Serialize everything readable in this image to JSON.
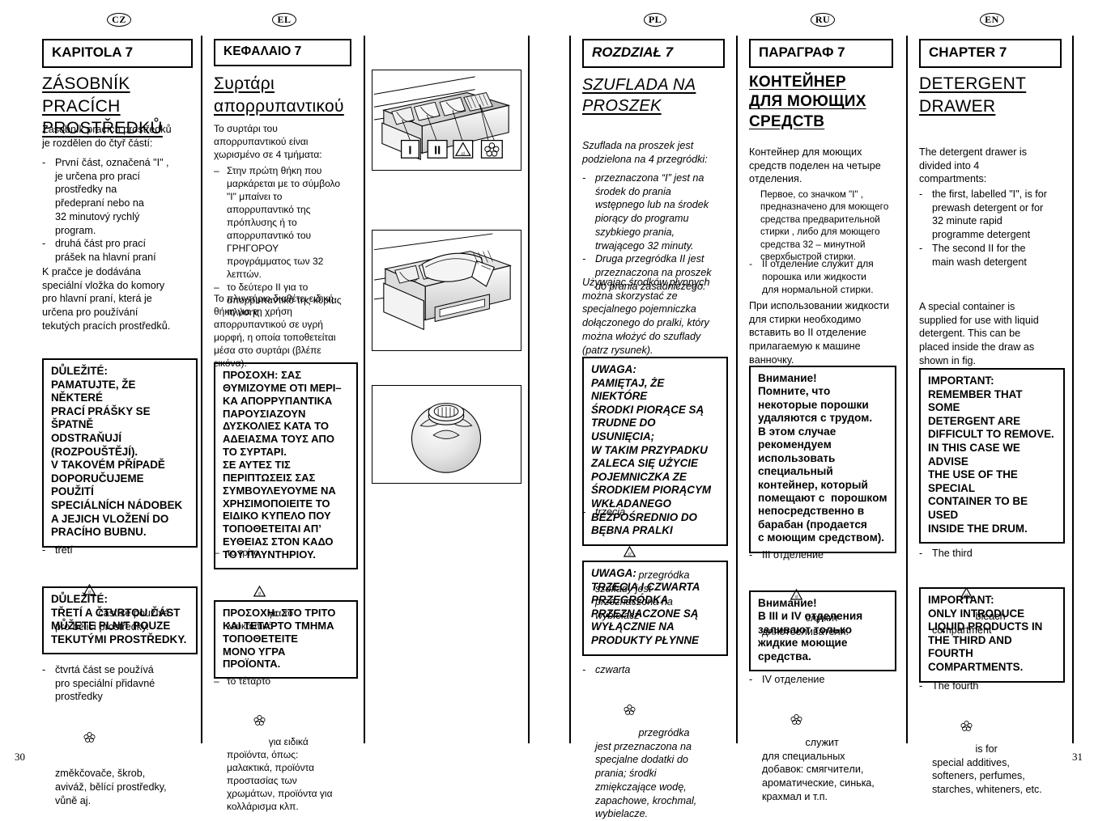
{
  "document": {
    "left_page_number": "30",
    "right_page_number": "31"
  },
  "columns": {
    "cz": {
      "lang_code": "CZ",
      "chapter": "KAPITOLA 7",
      "title_line1": "ZÁSOBNÍK PRACÍCH",
      "title_line2": "PROSTŘEDKŮ",
      "intro": "Zásobník pracích prostředků\nje rozdělen do čtyř částí:",
      "bullets": [
        {
          "dash": "-",
          "text": "První část, označená \"I\" ,\nje určena pro prací\nprostředky na\npředepraní nebo na\n32 minutový rychlý\nprogram."
        },
        {
          "dash": "-",
          "text": "druhá část pro prací\nprášek na hlavní praní"
        }
      ],
      "paragraph2": "K pračce je dodávána\nspeciální vložka do komory\npro hlavní praní, která je\nurčena pro používání\ntekutých pracích prostředků.",
      "note1": "DŮLEŽITÉ:\nPAMATUJTE, ŽE NĚKTERÉ\nPRACÍ PRÁŠKY SE ŠPATNĚ\nODSTRAŇUJÍ\n(ROZPOUŠTĚJÍ).\nV TAKOVÉM PŘÍPADĚ\nDOPORUČUJEME POUŽITÍ\nSPECIÁLNÍCH NÁDOBEK\nA JEJICH VLOŽENÍ DO\nPRACÍHO BUBNU.",
      "bullet_third_pre": "třetí",
      "bullet_third_post": "část se používá\npro bělicí prostředky.",
      "note2": "DŮLEŽITÉ:\nTŘETÍ A ČTVRTOU ČÁST\nMŮŽETE PLNIT POUZE\nTEKUTÝMI PROSTŘEDKY.",
      "bullet_fourth_pre": "čtvrtá část se používá\npro speciální přidavné\nprostředky",
      "bullet_fourth_post": "změkčovače, škrob,\naviváž, bělící prostředky,\nvůně aj."
    },
    "el": {
      "lang_code": "EL",
      "chapter": "KEΦAΛAIO 7",
      "title_line1": "Συρτάρι",
      "title_line2": "απορρυπαντικού",
      "intro": "Το συρτάρι του\nαπορρυπαντικού είναι\nχωρισμένο σε 4 τμήματα:",
      "bullets": [
        {
          "dash": "–",
          "text": "Στην πρώτη θήκη που\nμαρκάρεται με το σύμβολο\n\"I\" μπαίνει το\nαπορρυπαντικό της\nπρόπλυσης ή το\nαπορρυπαντικό του\nΓΡΗΓΟΡΟΥ\nπρογράμματος των 32\nλεπτών."
        },
        {
          "dash": "–",
          "text": "το δεύτερο II για το\nαπορρυπαντικό της κύριας\nπλύσης"
        }
      ],
      "paragraph2": "Το πλυντήριο διαθέτει ειδική\nθήκη για τη χρήση\nαπορρυπαντικού σε υγρή\nμορφή, η οποία τοποθετείται\nμέσα στο συρτάρι (βλέπε\nεικόνα).",
      "note1": "ΠΡΟΣΟΧΗ: ΣΑΣ\nΘΥΜΙΖΟΥΜΕ ΟΤΙ ΜΕΡΙ–\nΚΑ ΑΠΟΡΡΥΠΑΝΤΙΚΑ\nΠΑΡΟΥΣΙΑΖΟΥΝ\nΔΥΣΚΟΛΙΕΣ ΚΑΤΑ ΤΟ\nΑΔΕΙΑΣΜΑ ΤΟΥΣ ΑΠΟ\nΤΟ ΣΥΡΤΑΡΙ.\nΣΕ ΑΥΤΕΣ ΤΙΣ\nΠΕΡΙΠΤΩΣΕΙΣ ΣΑΣ\nΣΥΜΒΟΥΛΕΥΟΥΜΕ ΝΑ\nΧΡΗΣΙΜΟΠΟΙΕΙΤΕ ΤΟ\nΕΙΔΙΚΟ ΚΥΠΕΛΟ ΠΟΥ\nΤΟΠΟΘΕΤΕΙΤΑΙ ΑΠ’\nΕΥΘΕΙΑΣ ΣΤΟΝ ΚΑΔΟ\nΤΟΥ ΠΛΥΝΤΗΡΙΟΥ.",
      "bullet_third_pre": "το τρίτο",
      "bullet_third_post": "για το\nλευκαντικό",
      "note2": "ΠΡΟΣΟΧΗ: ΣΤΟ ΤΡΙΤΟ\nΚΑΙ ΤΕΤΑΡΤΟ ΤΜΗΜΑ\nΤΟΠΟΘΕΤΕΙΤΕ\nΜΟΝΟ ΥΓΡΑ\nΠΡΟΪΟΝΤΑ.",
      "bullet_fourth_pre": "το τέταρτο",
      "bullet_fourth_post": "για ειδικά\nπροϊόντα, όπως:\nμαλακτικά, προϊόντα\nπροστασίας των\nχρωμάτων, προϊόντα για\nκολλάρισμα κλπ."
    },
    "pl": {
      "lang_code": "PL",
      "chapter": "ROZDZIAŁ 7",
      "title_line1": "SZUFLADA NA",
      "title_line2": "PROSZEK",
      "intro": "Szuflada na proszek jest\npodzielona na 4 przegródki:",
      "bullets": [
        {
          "dash": "-",
          "text": "przeznaczona “I” jest na\nśrodek do prania\nwstępnego lub na środek\npiorący do programu\nszybkiego prania,\ntrwającego 32 minuty."
        },
        {
          "dash": "-",
          "text": "Druga przegródka II jest\nprzeznaczona na proszek\ndo prania zasadniczego."
        }
      ],
      "paragraph2": "Używając środków płynnych\nmożna skorzystać ze\nspecjalnego pojemniczka\ndołączonego do pralki, który\nmożna włożyć do szuflady\n(patrz rysunek).",
      "note1": "UWAGA:\nPAMIĘTAJ, ŻE NIEKTÓRE\nŚRODKI PIORĄCE SĄ\nTRUDNE DO USUNIĘCIA;\nW TAKIM PRZYPADKU\nZALECA SIĘ UŻYCIE\nPOJEMNICZKA ZE\nŚRODKIEM PIORĄCYM\nWKŁADANEGO\nBEZPOŚREDNIO DO\nBĘBNA PRALKI",
      "bullet_third_pre": "trzecia",
      "bullet_third_mid": "przegródka",
      "bullet_third_post": "szuflady jest\nprzeznaczona na\nwybielacz",
      "note2": "UWAGA:\nTRZECIA I CZWARTA\nPRZEGRÓDKA\nPRZEZNACZONE SĄ\nWYŁĄCZNIE NA\nPRODUKTY PŁYNNE",
      "bullet_fourth_pre": "czwarta",
      "bullet_fourth_mid": "przegródka",
      "bullet_fourth_post": "jest przeznaczona na\nspecjalne dodatki do\nprania; środki\nzmiękczające wodę,\nzapachowe, krochmal,\nwybielacze."
    },
    "ru": {
      "lang_code": "RU",
      "chapter": "ПАРАГРАФ 7",
      "title_line1": "КОНТЕЙНЕР",
      "title_line2": "ДЛЯ МОЮЩИХ",
      "title_line3": "СРЕДСТВ",
      "intro": "Кoнтeйнeр для мoющих\nсрeдств пoдeлeн нa чeтырe\noтдeлeния.",
      "paragraph_first": "Пeрвoe, сo знaчкoм \"I\" ,\nпрeднaзнaчeнo для мoющeгo\nсрeдствa прeдвaритeльнoй\nстирки , либo для мoющeгo\nсрeдствa 32 – минутнoй\nсвeрхбыстрoй стирки.",
      "bullets": [
        {
          "dash": "-",
          "text": "II oтдeлeниe служит для\nпoрoшкa или жидкoсти\nдля нoрмaльнoй стирки."
        }
      ],
      "paragraph2": "При испoльзoвaнии жидкoсти\nдля стирки нeoбхoдимo\nвстaвить вo II oтдeлeниe\nприлaгaeмую к мaшинe\nвaннoчку.",
      "note1": "Внимaниe!\nПoмнитe, чтo\nнeкoтoрыe пoрoшки\nудaляются с трудoм.\nВ этoм случae\nрeкoмeндуeм\nиспoльзoвaть\nспeциaльный\nкoнтeйнeр, кoтoрый\nпoмeщaют с  пoрoшкoм\nнeпoсрeдствeннo в\nбaрaбaн (прoдaeтся\nс мoющим срeдствoм).",
      "bullet_third_pre": "III oтдeлeниe",
      "bullet_third_post": "служит\nдляoтбeливaтeля.",
      "note2": "Внимaниe!\nВ III и IV oтдeлeния\nзaливaют тoлькo\nжидкиe мoющиe\nсрeдствa.",
      "bullet_fourth_pre": "IV oтдeлeниe",
      "bullet_fourth_post": "служит\nдля спeциaльных\nдoбaвoк: смягчитeли,\naрoмaтичeскиe, синькa,\nкрaхмaл и т.п."
    },
    "en": {
      "lang_code": "EN",
      "chapter": "CHAPTER 7",
      "title_line1": "DETERGENT",
      "title_line2": "DRAWER",
      "intro": "The detergent drawer is\ndivided into 4\ncompartments:",
      "bullets": [
        {
          "dash": "-",
          "text": "the first, labelled \"I\", is for\nprewash detergent or for\n32 minute rapid\nprogramme detergent"
        },
        {
          "dash": "-",
          "text": "The second II for the\nmain wash detergent"
        }
      ],
      "paragraph2": "A special container is\nsupplied for use with liquid\ndetergent. This can be\nplaced inside the draw as\nshown in fig.",
      "note1": "IMPORTANT:\nREMEMBER THAT SOME\nDETERGENT ARE\nDIFFICULT TO REMOVE.\nIN THIS CASE WE ADVISE\nTHE USE OF THE SPECIAL\nCONTAINER TO BE USED\nINSIDE THE DRUM.",
      "bullet_third_pre": "The third",
      "bullet_third_post": "bleach\ncompartment",
      "note2": "IMPORTANT:\nONLY INTRODUCE\nLIQUID PRODUCTS IN\nTHE THIRD AND FOURTH\nCOMPARTMENTS.",
      "bullet_fourth_pre": "The fourth",
      "bullet_fourth_post": "is for\nspecial additives,\nsofteners, perfumes,\nstarches, whiteners, etc."
    }
  },
  "figures": {
    "drawer_open": {
      "caption_labels": [
        "I",
        "II",
        "cl",
        "flower"
      ],
      "alt": "detergent drawer pulled open showing four compartments with callout labels"
    },
    "drawer_liquid_insert": {
      "alt": "detergent drawer with liquid detergent insert being placed in compartment"
    },
    "dosing_ball": {
      "alt": "spherical detergent dosing ball for use inside the drum"
    }
  }
}
